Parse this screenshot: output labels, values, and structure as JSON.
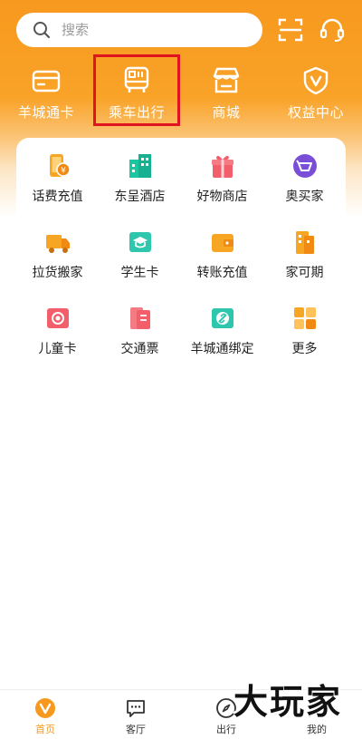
{
  "search": {
    "placeholder": "搜索"
  },
  "quick_actions": [
    {
      "label": "羊城通卡",
      "icon": "card-icon"
    },
    {
      "label": "乘车出行",
      "icon": "bus-icon"
    },
    {
      "label": "商城",
      "icon": "store-icon"
    },
    {
      "label": "权益中心",
      "icon": "shield-v-icon"
    }
  ],
  "highlighted_action": "乘车出行",
  "grid": [
    {
      "label": "话费充值",
      "icon": "phone-recharge-icon"
    },
    {
      "label": "东呈酒店",
      "icon": "hotel-icon"
    },
    {
      "label": "好物商店",
      "icon": "gift-icon"
    },
    {
      "label": "奥买家",
      "icon": "shopping-icon"
    },
    {
      "label": "拉货搬家",
      "icon": "truck-icon"
    },
    {
      "label": "学生卡",
      "icon": "student-card-icon"
    },
    {
      "label": "转账充值",
      "icon": "wallet-icon"
    },
    {
      "label": "家可期",
      "icon": "home-icon"
    },
    {
      "label": "儿童卡",
      "icon": "child-card-icon"
    },
    {
      "label": "交通票",
      "icon": "ticket-icon"
    },
    {
      "label": "羊城通绑定",
      "icon": "link-icon"
    },
    {
      "label": "更多",
      "icon": "more-icon"
    }
  ],
  "nav": [
    {
      "label": "首页",
      "icon": "home-v-icon",
      "active": true
    },
    {
      "label": "客厅",
      "icon": "chat-icon",
      "active": false
    },
    {
      "label": "出行",
      "icon": "compass-icon",
      "active": false
    },
    {
      "label": "我的",
      "icon": "profile-icon",
      "active": false
    }
  ],
  "watermark": "大玩家",
  "colors": {
    "brand_orange": "#f7991e",
    "highlight_red": "#e0141e",
    "text_dark": "#222222"
  }
}
